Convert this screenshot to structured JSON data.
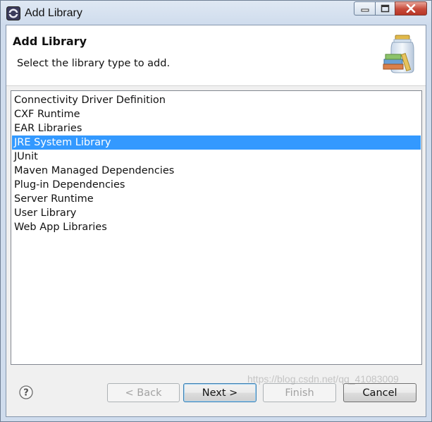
{
  "window": {
    "title": "Add Library",
    "controls": {
      "minimize": "minimize",
      "maximize": "maximize",
      "close": "close"
    }
  },
  "header": {
    "title": "Add Library",
    "description": "Select the library type to add."
  },
  "library_types": {
    "items": [
      {
        "label": "Connectivity Driver Definition",
        "selected": false
      },
      {
        "label": "CXF Runtime",
        "selected": false
      },
      {
        "label": "EAR Libraries",
        "selected": false
      },
      {
        "label": "JRE System Library",
        "selected": true
      },
      {
        "label": "JUnit",
        "selected": false
      },
      {
        "label": "Maven Managed Dependencies",
        "selected": false
      },
      {
        "label": "Plug-in Dependencies",
        "selected": false
      },
      {
        "label": "Server Runtime",
        "selected": false
      },
      {
        "label": "User Library",
        "selected": false
      },
      {
        "label": "Web App Libraries",
        "selected": false
      }
    ]
  },
  "footer": {
    "help_icon": "question-circle-icon",
    "back_label": "< Back",
    "next_label": "Next >",
    "finish_label": "Finish",
    "cancel_label": "Cancel",
    "back_enabled": false,
    "finish_enabled": false
  },
  "watermark": "https://blog.csdn.net/qq_41083009",
  "colors": {
    "selection": "#3399ff",
    "frame": "#cfdced",
    "close_button": "#c74a3a"
  }
}
